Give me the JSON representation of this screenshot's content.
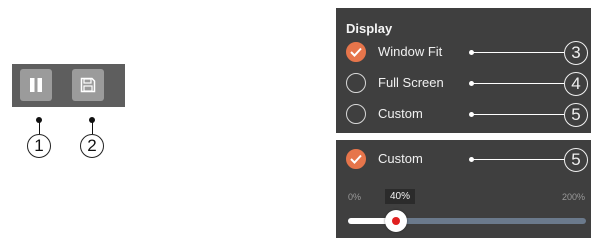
{
  "toolbar": {
    "buttons": [
      {
        "icon": "pause-icon",
        "callout": "1"
      },
      {
        "icon": "save-icon",
        "callout": "2"
      }
    ]
  },
  "display_panel": {
    "title": "Display",
    "options": [
      {
        "label": "Window Fit",
        "selected": true,
        "callout": "3"
      },
      {
        "label": "Full Screen",
        "selected": false,
        "callout": "4"
      },
      {
        "label": "Custom",
        "selected": false,
        "callout": "5"
      }
    ]
  },
  "custom_panel": {
    "option": {
      "label": "Custom",
      "selected": true,
      "callout": "5"
    },
    "slider": {
      "min_label": "0%",
      "max_label": "200%",
      "value_label": "40%",
      "value_percent": 40
    }
  },
  "colors": {
    "accent": "#e6754b",
    "panel_bg": "#3f3f3f",
    "toolbar_bg": "#5e5e5e",
    "thumb_dot": "#e02020"
  }
}
